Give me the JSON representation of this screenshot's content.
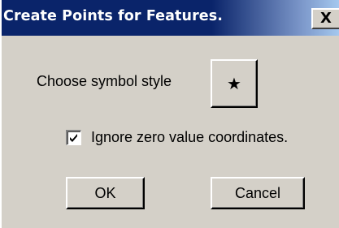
{
  "dialog": {
    "title": "Create Points for Features.",
    "close_glyph": "X",
    "symbol_label": "Choose symbol style",
    "symbol_glyph": "★",
    "symbol_icon": "star-icon",
    "checkbox_label": "Ignore zero value coordinates.",
    "checkbox_checked": true,
    "ok_label": "OK",
    "cancel_label": "Cancel"
  },
  "colors": {
    "titlebar": "#0a246a",
    "face": "#d4d0c8",
    "title_text": "#ffffff"
  }
}
